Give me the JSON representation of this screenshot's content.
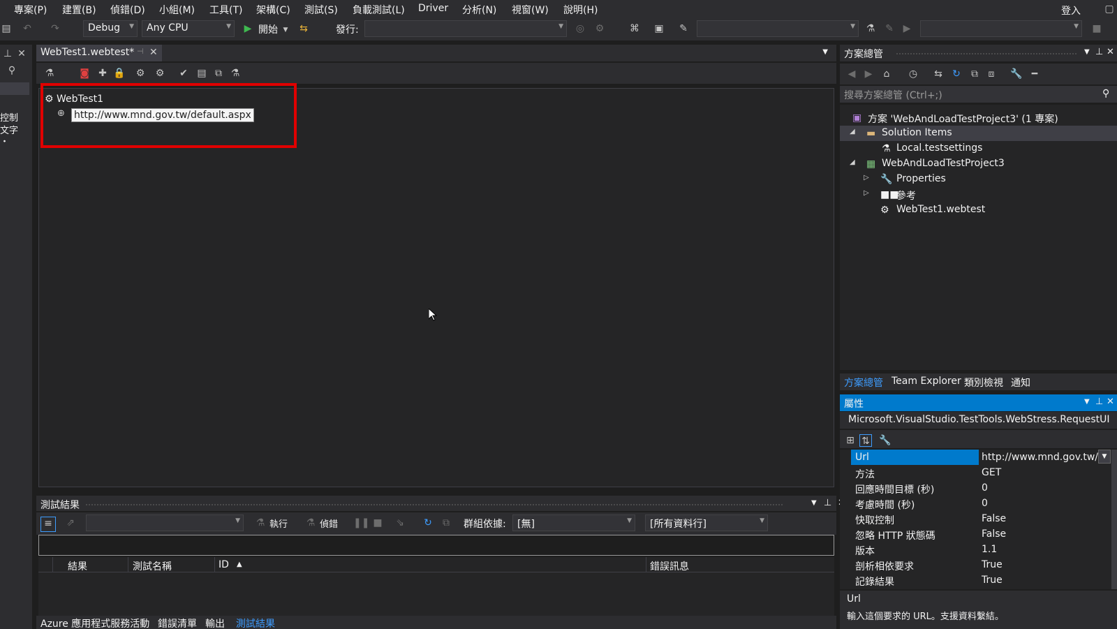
{
  "menu": {
    "items": [
      "專案(P)",
      "建置(B)",
      "偵錯(D)",
      "小組(M)",
      "工具(T)",
      "架構(C)",
      "測試(S)",
      "負載測試(L)",
      "Driver",
      "分析(N)",
      "視窗(W)",
      "說明(H)"
    ],
    "signin": "登入"
  },
  "toolbar": {
    "config": "Debug",
    "platform": "Any CPU",
    "start_label": "開始",
    "publish_label": "發行:"
  },
  "left_strip": {
    "labels": [
      "控制",
      "文字",
      "・"
    ]
  },
  "document": {
    "tab_title": "WebTest1.webtest*",
    "tree_root": "WebTest1",
    "request_url": "http://www.mnd.gov.tw/default.aspx"
  },
  "test_results": {
    "title": "測試結果",
    "run_label": "執行",
    "debug_label": "偵錯",
    "group_by_label": "群組依據:",
    "group_by_value": "[無]",
    "filter_value": "[所有資料行]",
    "columns": [
      "結果",
      "測試名稱",
      "ID",
      "錯誤訊息"
    ]
  },
  "bottom_tabs": [
    "Azure 應用程式服務活動",
    "錯誤清單",
    "輸出",
    "測試結果"
  ],
  "solution_explorer": {
    "title": "方案總管",
    "search_placeholder": "搜尋方案總管 (Ctrl+;)",
    "items": [
      {
        "label": "方案 'WebAndLoadTestProject3' (1 專案)",
        "icon": "solution-icon"
      },
      {
        "label": "Solution Items",
        "icon": "folder-icon"
      },
      {
        "label": "Local.testsettings",
        "icon": "testsettings-icon"
      },
      {
        "label": "WebAndLoadTestProject3",
        "icon": "project-icon"
      },
      {
        "label": "Properties",
        "icon": "wrench-icon"
      },
      {
        "label": "參考",
        "icon": "reference-icon"
      },
      {
        "label": "WebTest1.webtest",
        "icon": "webtest-icon"
      }
    ],
    "tabs": [
      "方案總管",
      "Team Explorer",
      "類別檢視",
      "通知"
    ]
  },
  "properties": {
    "title": "屬性",
    "object": "Microsoft.VisualStudio.TestTools.WebStress.RequestUI",
    "rows": [
      {
        "name": "Url",
        "value": "http://www.mnd.gov.tw/"
      },
      {
        "name": "方法",
        "value": "GET"
      },
      {
        "name": "回應時間目標 (秒)",
        "value": "0"
      },
      {
        "name": "考慮時間 (秒)",
        "value": "0"
      },
      {
        "name": "快取控制",
        "value": "False"
      },
      {
        "name": "忽略 HTTP 狀態碼",
        "value": "False"
      },
      {
        "name": "版本",
        "value": "1.1"
      },
      {
        "name": "剖析相依要求",
        "value": "True"
      },
      {
        "name": "記錄結果",
        "value": "True"
      }
    ],
    "desc_title": "Url",
    "desc_text": "輸入這個要求的 URL。支援資料繫結。"
  },
  "colors": {
    "accent": "#007acc",
    "highlight": "#e00000",
    "active_tab_text": "#3e9dff"
  }
}
